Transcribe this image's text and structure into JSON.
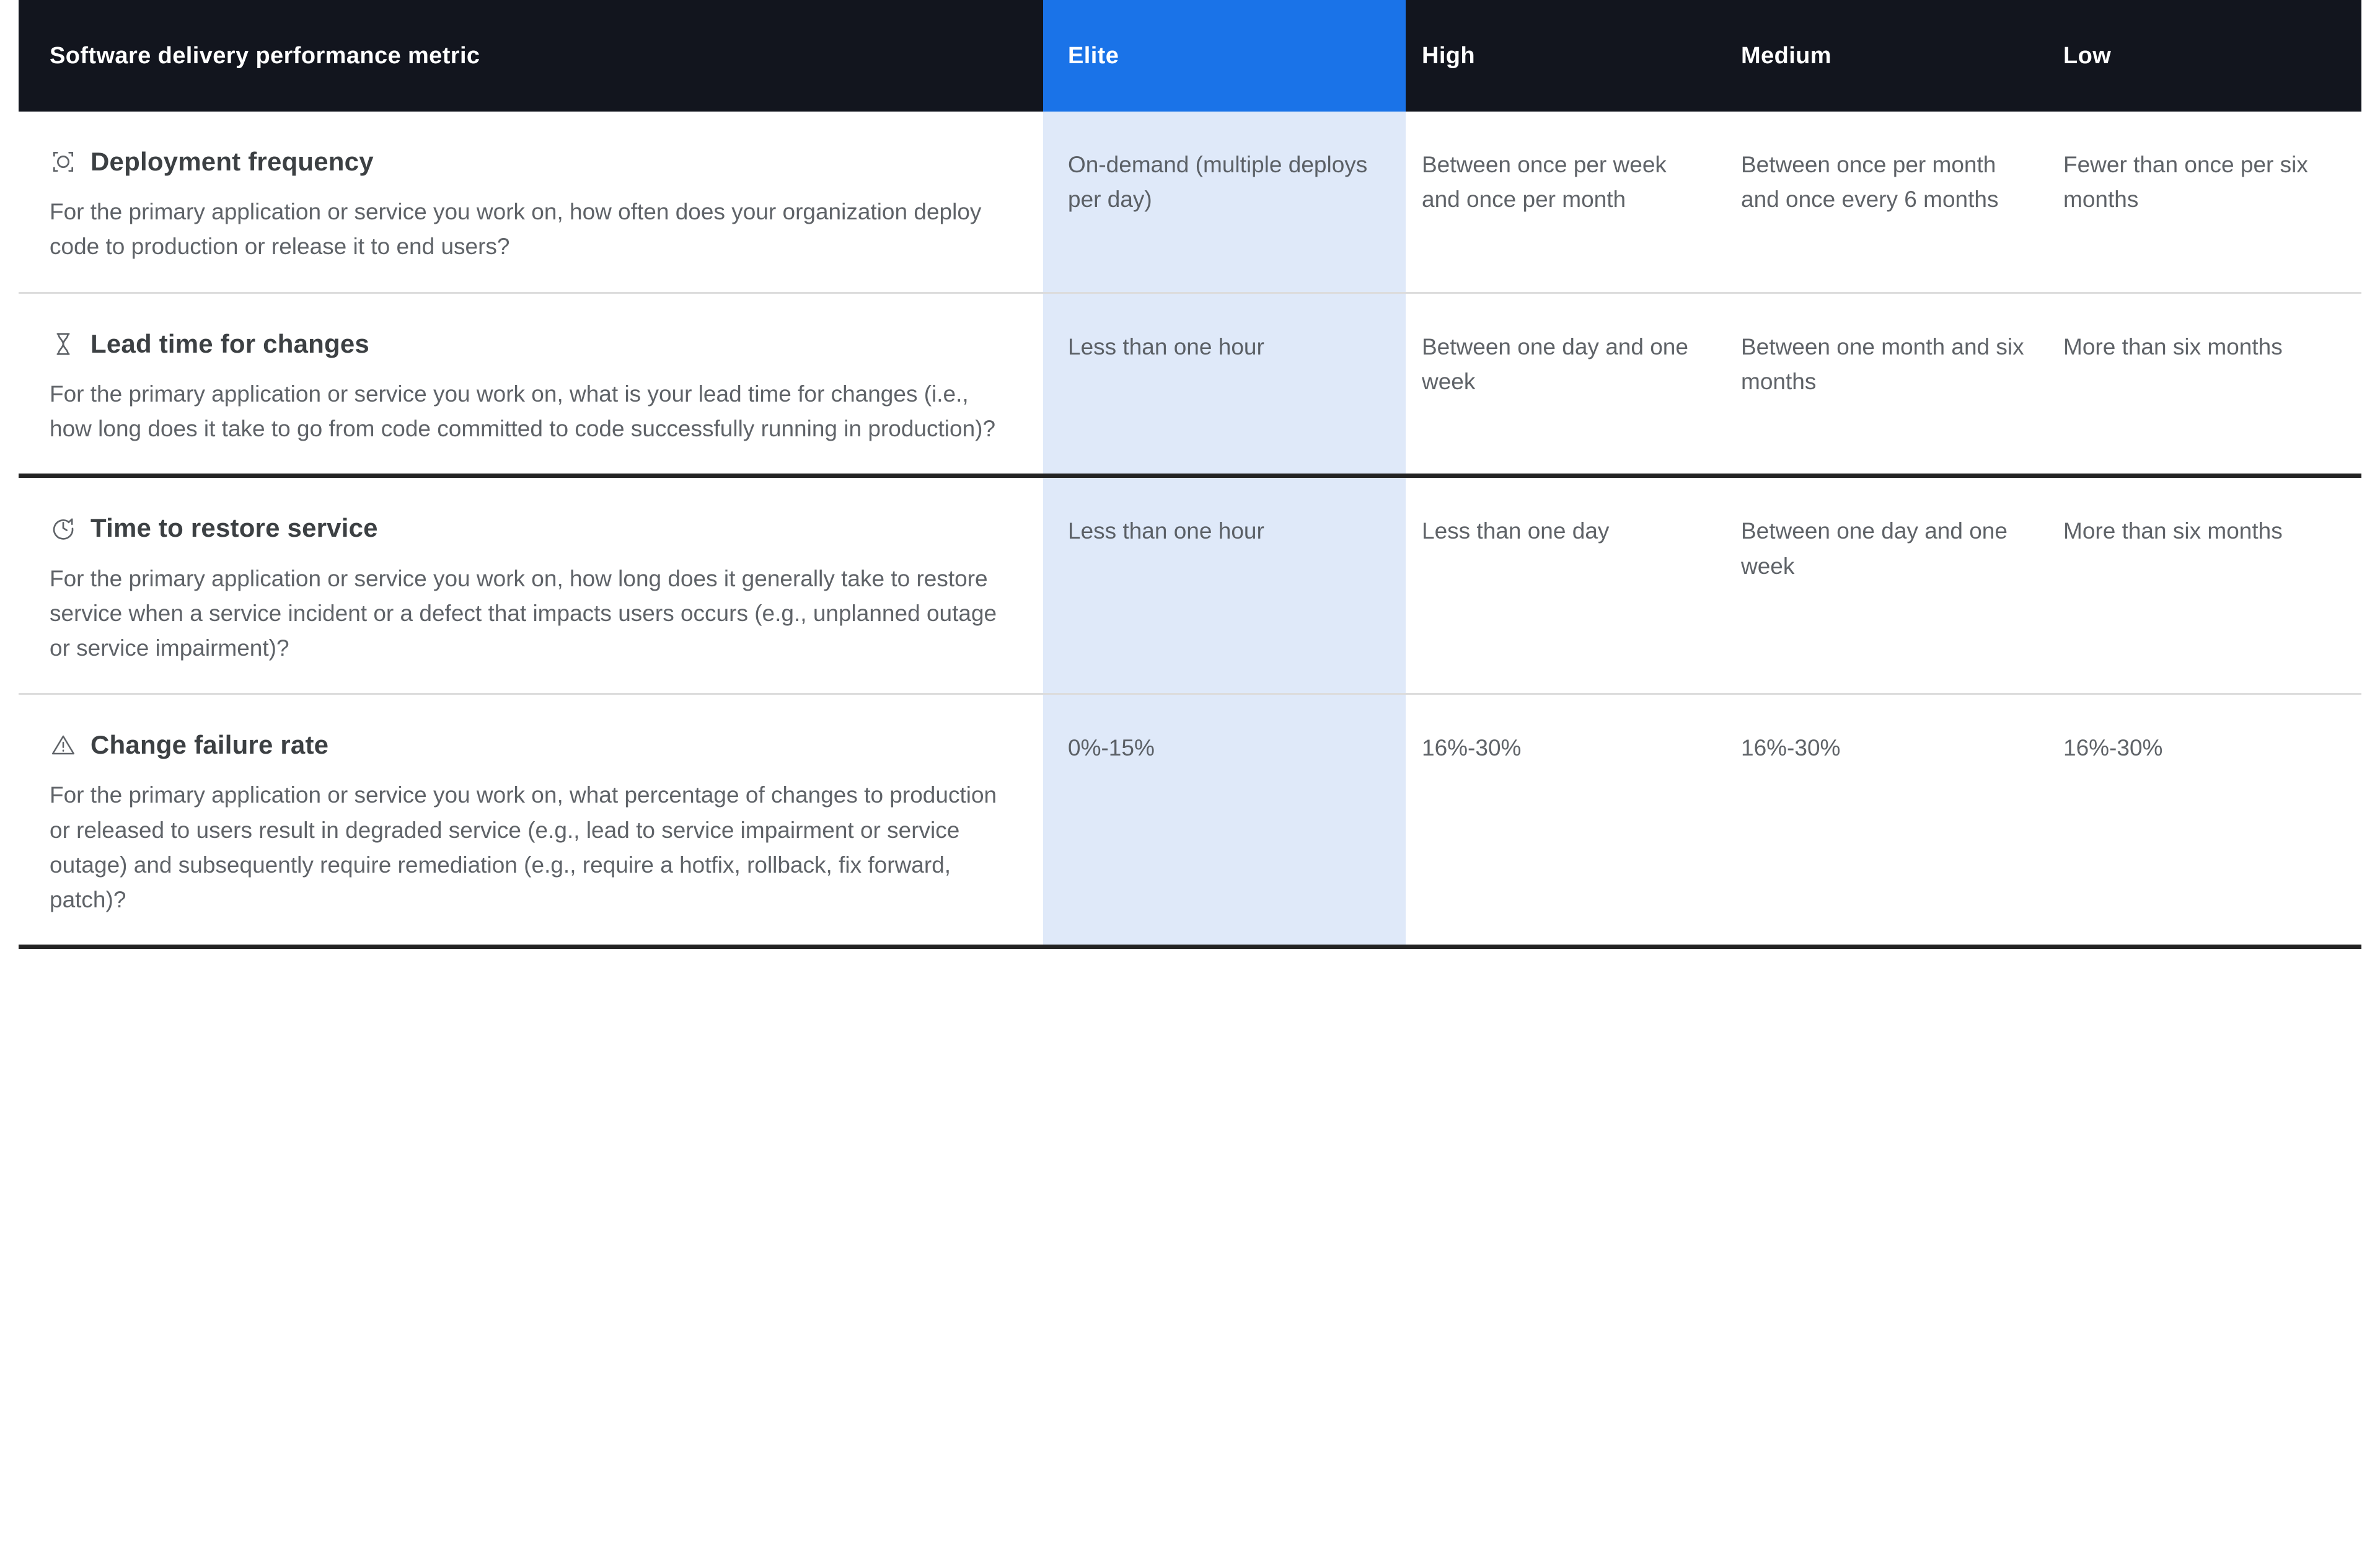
{
  "table": {
    "columns": [
      {
        "key": "metric",
        "label": "Software delivery performance metric"
      },
      {
        "key": "elite",
        "label": "Elite"
      },
      {
        "key": "high",
        "label": "High"
      },
      {
        "key": "medium",
        "label": "Medium"
      },
      {
        "key": "low",
        "label": "Low"
      }
    ],
    "colors": {
      "header_background": "#12151e",
      "elite_header_background": "#1a73e8",
      "elite_column_background": "#dfe9f9",
      "header_text": "#ffffff",
      "body_text": "#5f6368",
      "title_text": "#3c4043",
      "divider_light": "#dcdcdc",
      "divider_dark": "#232323"
    },
    "rows": [
      {
        "icon": "target-icon",
        "title": "Deployment frequency",
        "description": "For the primary application or service you work on, how often does your organization deploy code to production or release it to end users?",
        "elite": "On-demand (multiple deploys per day)",
        "high": "Between once per week and once per month",
        "medium": "Between once per month and once every 6 months",
        "low": "Fewer than once per six months"
      },
      {
        "icon": "hourglass-icon",
        "title": "Lead time for changes",
        "description": "For the primary application or service you work on, what is your lead time for changes (i.e., how long does it take to go from code committed to code successfully running in production)?",
        "elite": "Less than one hour",
        "high": "Between one day and one week",
        "medium": "Between one month and six months",
        "low": "More than six months"
      },
      {
        "icon": "restore-clock-icon",
        "title": "Time to restore service",
        "description": "For the primary application or service you work on, how long does it generally take to restore service when a service incident or a defect that impacts users occurs (e.g., unplanned outage or service impairment)?",
        "elite": "Less than one hour",
        "high": "Less than one day",
        "medium": "Between one day and one week",
        "low": "More than six months"
      },
      {
        "icon": "warning-triangle-icon",
        "title": "Change failure rate",
        "description": "For the primary application or service you work on, what percentage of changes to production or released to users result in degraded service (e.g., lead to service impairment or service outage) and subsequently require remediation (e.g., require a hotfix, rollback, fix forward, patch)?",
        "elite": "0%-15%",
        "high": "16%-30%",
        "medium": "16%-30%",
        "low": "16%-30%"
      }
    ]
  }
}
